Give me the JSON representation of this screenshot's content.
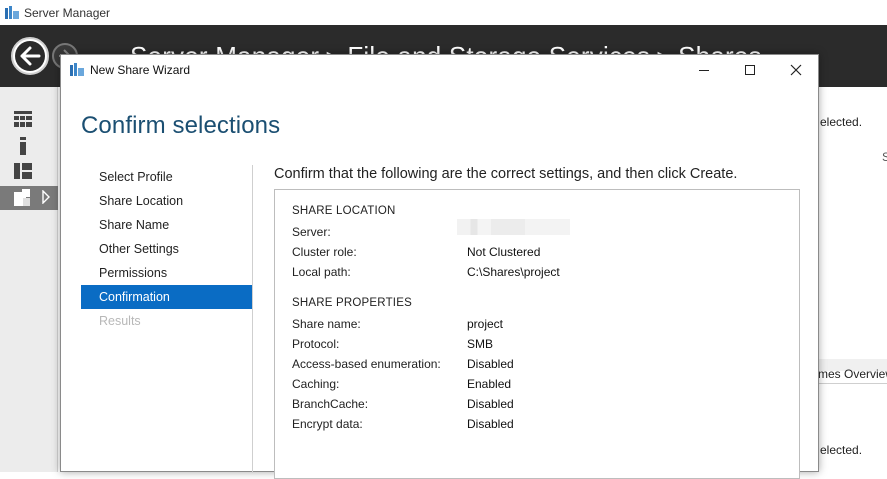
{
  "server_manager": {
    "title": "Server Manager",
    "breadcrumb": "Server Manager ▸ File and Storage Services ▸ Shares",
    "right_panel": {
      "selected_top": "elected.",
      "s_char": "S",
      "volumes_overview": "mes Overview",
      "selected_bottom": "elected."
    }
  },
  "wizard": {
    "title": "New Share Wizard",
    "heading": "Confirm selections",
    "steps": [
      {
        "label": "Select Profile",
        "state": "normal"
      },
      {
        "label": "Share Location",
        "state": "normal"
      },
      {
        "label": "Share Name",
        "state": "normal"
      },
      {
        "label": "Other Settings",
        "state": "normal"
      },
      {
        "label": "Permissions",
        "state": "normal"
      },
      {
        "label": "Confirmation",
        "state": "active"
      },
      {
        "label": "Results",
        "state": "disabled"
      }
    ],
    "instruction": "Confirm that the following are the correct settings, and then click Create.",
    "share_location": {
      "heading": "SHARE LOCATION",
      "server_label": "Server:",
      "server_value": "",
      "cluster_role_label": "Cluster role:",
      "cluster_role_value": "Not Clustered",
      "local_path_label": "Local path:",
      "local_path_value": "C:\\Shares\\project"
    },
    "share_properties": {
      "heading": "SHARE PROPERTIES",
      "rows": [
        {
          "label": "Share name:",
          "value": "project"
        },
        {
          "label": "Protocol:",
          "value": "SMB"
        },
        {
          "label": "Access-based enumeration:",
          "value": "Disabled"
        },
        {
          "label": "Caching:",
          "value": "Enabled"
        },
        {
          "label": "BranchCache:",
          "value": "Disabled"
        },
        {
          "label": "Encrypt data:",
          "value": "Disabled"
        }
      ]
    }
  },
  "colors": {
    "accent": "#0a6cc4",
    "heading": "#1b4f72",
    "header_bg": "#2b2b2b"
  }
}
